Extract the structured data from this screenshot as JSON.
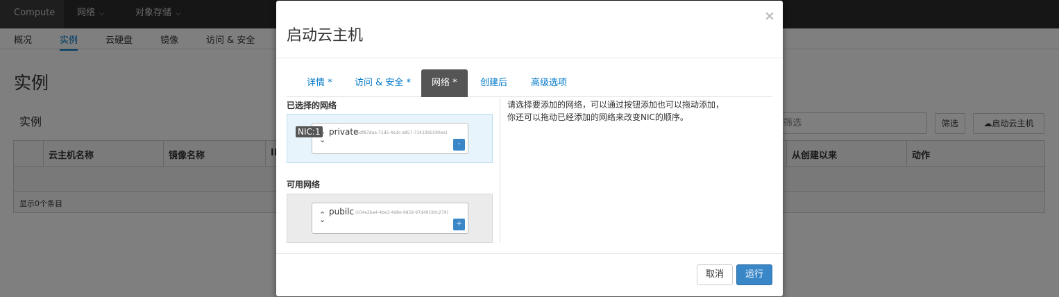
{
  "topnav": {
    "items": [
      {
        "label": "Compute"
      },
      {
        "label": "网络"
      },
      {
        "label": "对象存储"
      }
    ]
  },
  "subnav": {
    "items": [
      {
        "label": "概况"
      },
      {
        "label": "实例"
      },
      {
        "label": "云硬盘"
      },
      {
        "label": "镜像"
      },
      {
        "label": "访问 & 安全"
      }
    ]
  },
  "page": {
    "title": "实例",
    "section_title": "实例",
    "filter_placeholder": "筛选",
    "filter_button": "筛选",
    "launch_button": "启动云主机"
  },
  "table": {
    "columns": [
      "云主机名称",
      "镜像名称",
      "IP",
      "从创建以来",
      "动作"
    ],
    "footer": "显示0个条目"
  },
  "modal": {
    "title": "启动云主机",
    "close": "×",
    "tabs": [
      {
        "label": "详情 *"
      },
      {
        "label": "访问 & 安全 *"
      },
      {
        "label": "网络 *"
      },
      {
        "label": "创建后"
      },
      {
        "label": "高级选项"
      }
    ],
    "selected_label": "已选择的网络",
    "available_label": "可用网络",
    "selected_networks": [
      {
        "nic": "NIC:1",
        "name": "private",
        "id": "(6df87daa-71d5-4e3c-a857-7143395590ea)",
        "action": "-"
      }
    ],
    "available_networks": [
      {
        "name": "pubilc",
        "id": "(c04e2ba4-4be3-4d8e-9859-97d49190c279)",
        "action": "+"
      }
    ],
    "help_text": "请选择要添加的网络，可以通过按钮添加也可以拖动添加，你还可以拖动已经添加的网络来改变NIC的顺序。",
    "cancel": "取消",
    "run": "运行"
  }
}
